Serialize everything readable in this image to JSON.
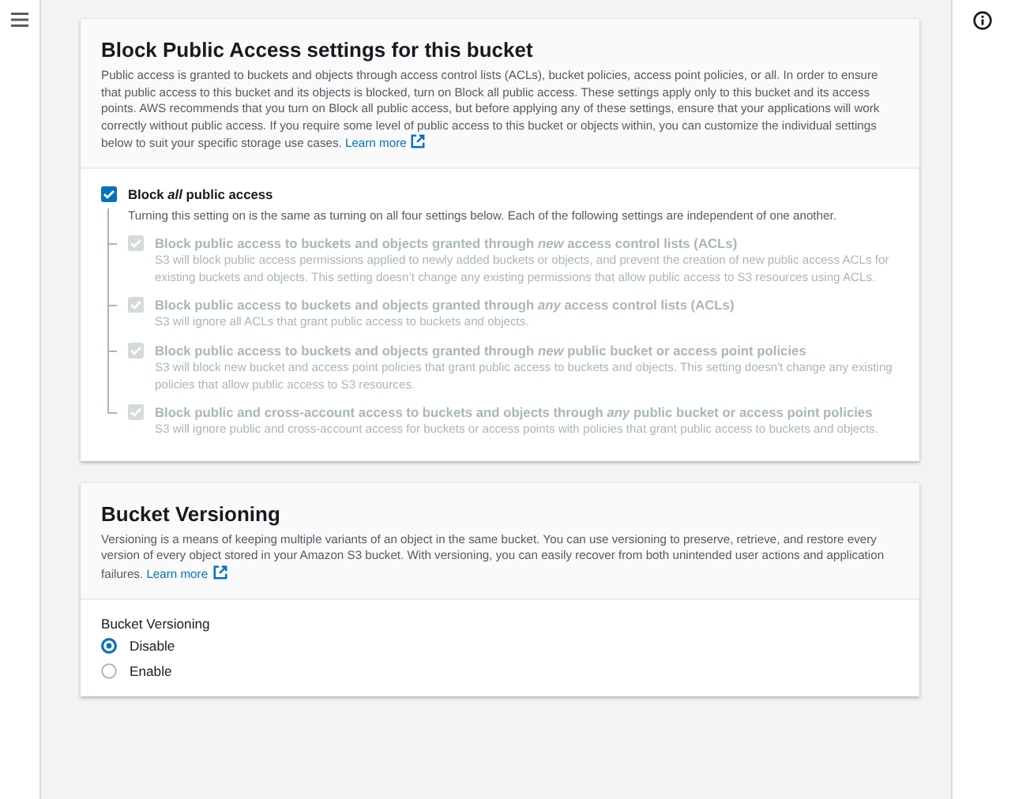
{
  "access_panel": {
    "title": "Block Public Access settings for this bucket",
    "description": "Public access is granted to buckets and objects through access control lists (ACLs), bucket policies, access point policies, or all. In order to ensure that public access to this bucket and its objects is blocked, turn on Block all public access. These settings apply only to this bucket and its access points. AWS recommends that you turn on Block all public access, but before applying any of these settings, ensure that your applications will work correctly without public access. If you require some level of public access to this bucket or objects within, you can customize the individual settings below to suit your specific storage use cases.",
    "link": "Learn more",
    "master": {
      "label": "Block *all* public access",
      "description": "Turning this setting on is the same as turning on all four settings below. Each of the following settings are independent of one another.",
      "checked": true,
      "disabled": false
    },
    "options": [
      {
        "label": "Block public access to buckets and objects granted through *new* access control lists (ACLs)",
        "description": "S3 will block public access permissions applied to newly added buckets or objects, and prevent the creation of new public access ACLs for existing buckets and objects. This setting doesn’t change any existing permissions that allow public access to S3 resources using ACLs.",
        "checked": true,
        "disabled": true
      },
      {
        "label": "Block public access to buckets and objects granted through *any* access control lists (ACLs)",
        "description": "S3 will ignore all ACLs that grant public access to buckets and objects.",
        "checked": true,
        "disabled": true
      },
      {
        "label": "Block public access to buckets and objects granted through *new* public bucket or access point policies",
        "description": "S3 will block new bucket and access point policies that grant public access to buckets and objects. This setting doesn't change any existing policies that allow public access to S3 resources.",
        "checked": true,
        "disabled": true
      },
      {
        "label": "Block public and cross-account access to buckets and objects through *any* public bucket or access point policies",
        "description": "S3 will ignore public and cross-account access for buckets or access points with policies that grant public access to buckets and objects.",
        "checked": true,
        "disabled": true
      }
    ]
  },
  "versioning_panel": {
    "title": "Bucket Versioning",
    "description": "Versioning is a means of keeping multiple variants of an object in the same bucket. You can use versioning to preserve, retrieve, and restore every version of every object stored in your Amazon S3 bucket. With versioning, you can easily recover from both unintended user actions and application failures.",
    "link": "Learn more",
    "field_label": "Bucket Versioning",
    "options": [
      {
        "label": "Disable",
        "selected": true
      },
      {
        "label": "Enable",
        "selected": false
      }
    ]
  }
}
